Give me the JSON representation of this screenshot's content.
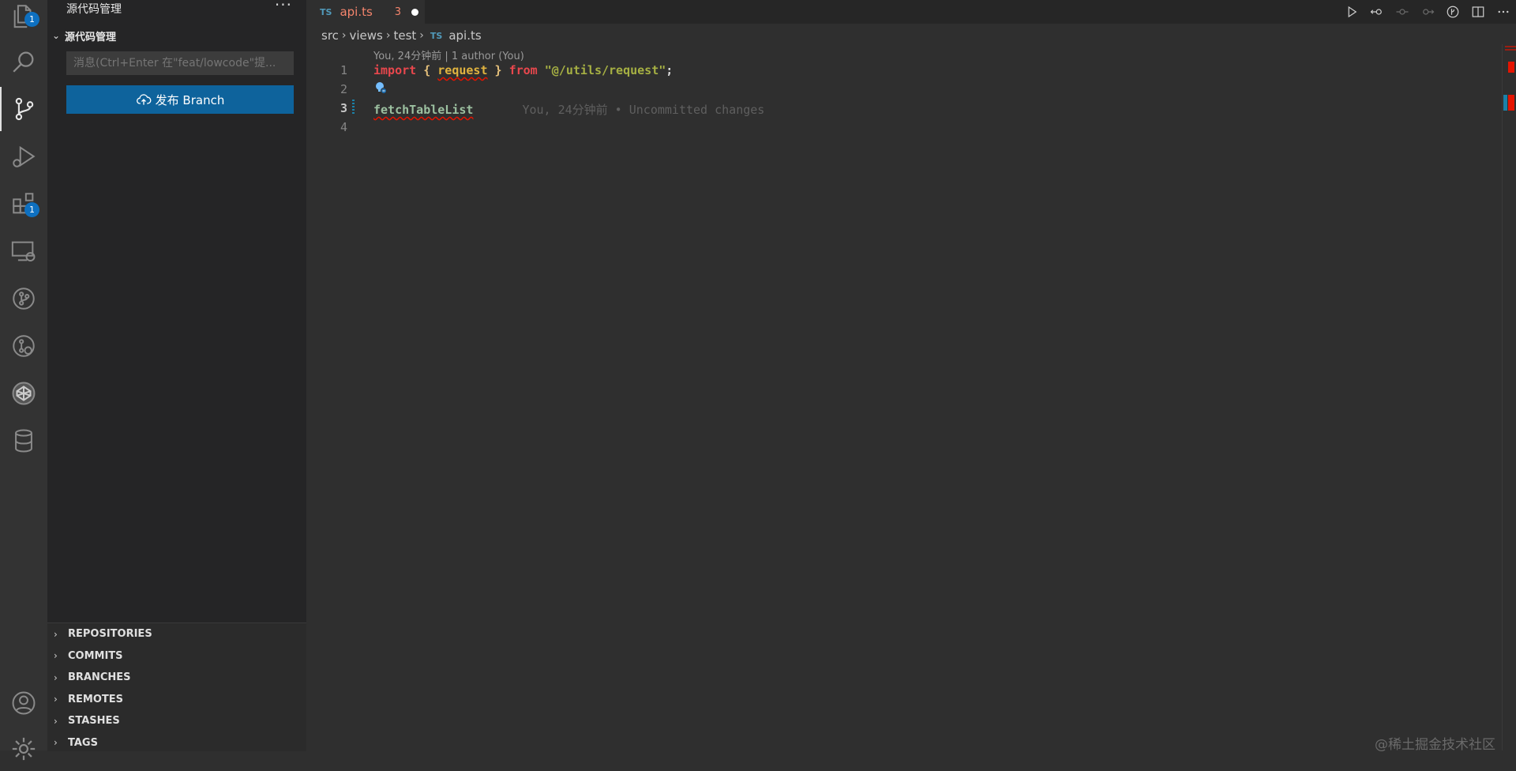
{
  "activity_bar": {
    "explorer_badge": "1",
    "extensions_badge": "1"
  },
  "sidebar": {
    "title": "源代码管理",
    "more": "···",
    "section_title": "源代码管理",
    "message_placeholder": "消息(Ctrl+Enter 在\"feat/lowcode\"提...",
    "publish_button": "发布 Branch",
    "footer_sections": [
      "REPOSITORIES",
      "COMMITS",
      "BRANCHES",
      "REMOTES",
      "STASHES",
      "TAGS"
    ]
  },
  "editor": {
    "tab": {
      "lang": "TS",
      "name": "api.ts",
      "problem_count": "3"
    },
    "breadcrumbs": [
      "src",
      "views",
      "test"
    ],
    "breadcrumb_file": "api.ts",
    "codelens": "You, 24分钟前 | 1 author (You)",
    "line_numbers": [
      "1",
      "2",
      "3",
      "4"
    ],
    "code": {
      "line1_import": "import",
      "line1_open": "{",
      "line1_ident": "request",
      "line1_close": "}",
      "line1_from": "from",
      "line1_string": "\"@/utils/request\"",
      "line1_semi": ";",
      "line3_ident": "fetchTableList",
      "line3_blame": "You, 24分钟前 • Uncommitted changes"
    }
  },
  "watermark": "@稀土掘金技术社区",
  "colors": {
    "accent": "#0e639c",
    "badge": "#0e70c0",
    "error_underline": "#e51400",
    "tab_modified": "#f4846c"
  }
}
